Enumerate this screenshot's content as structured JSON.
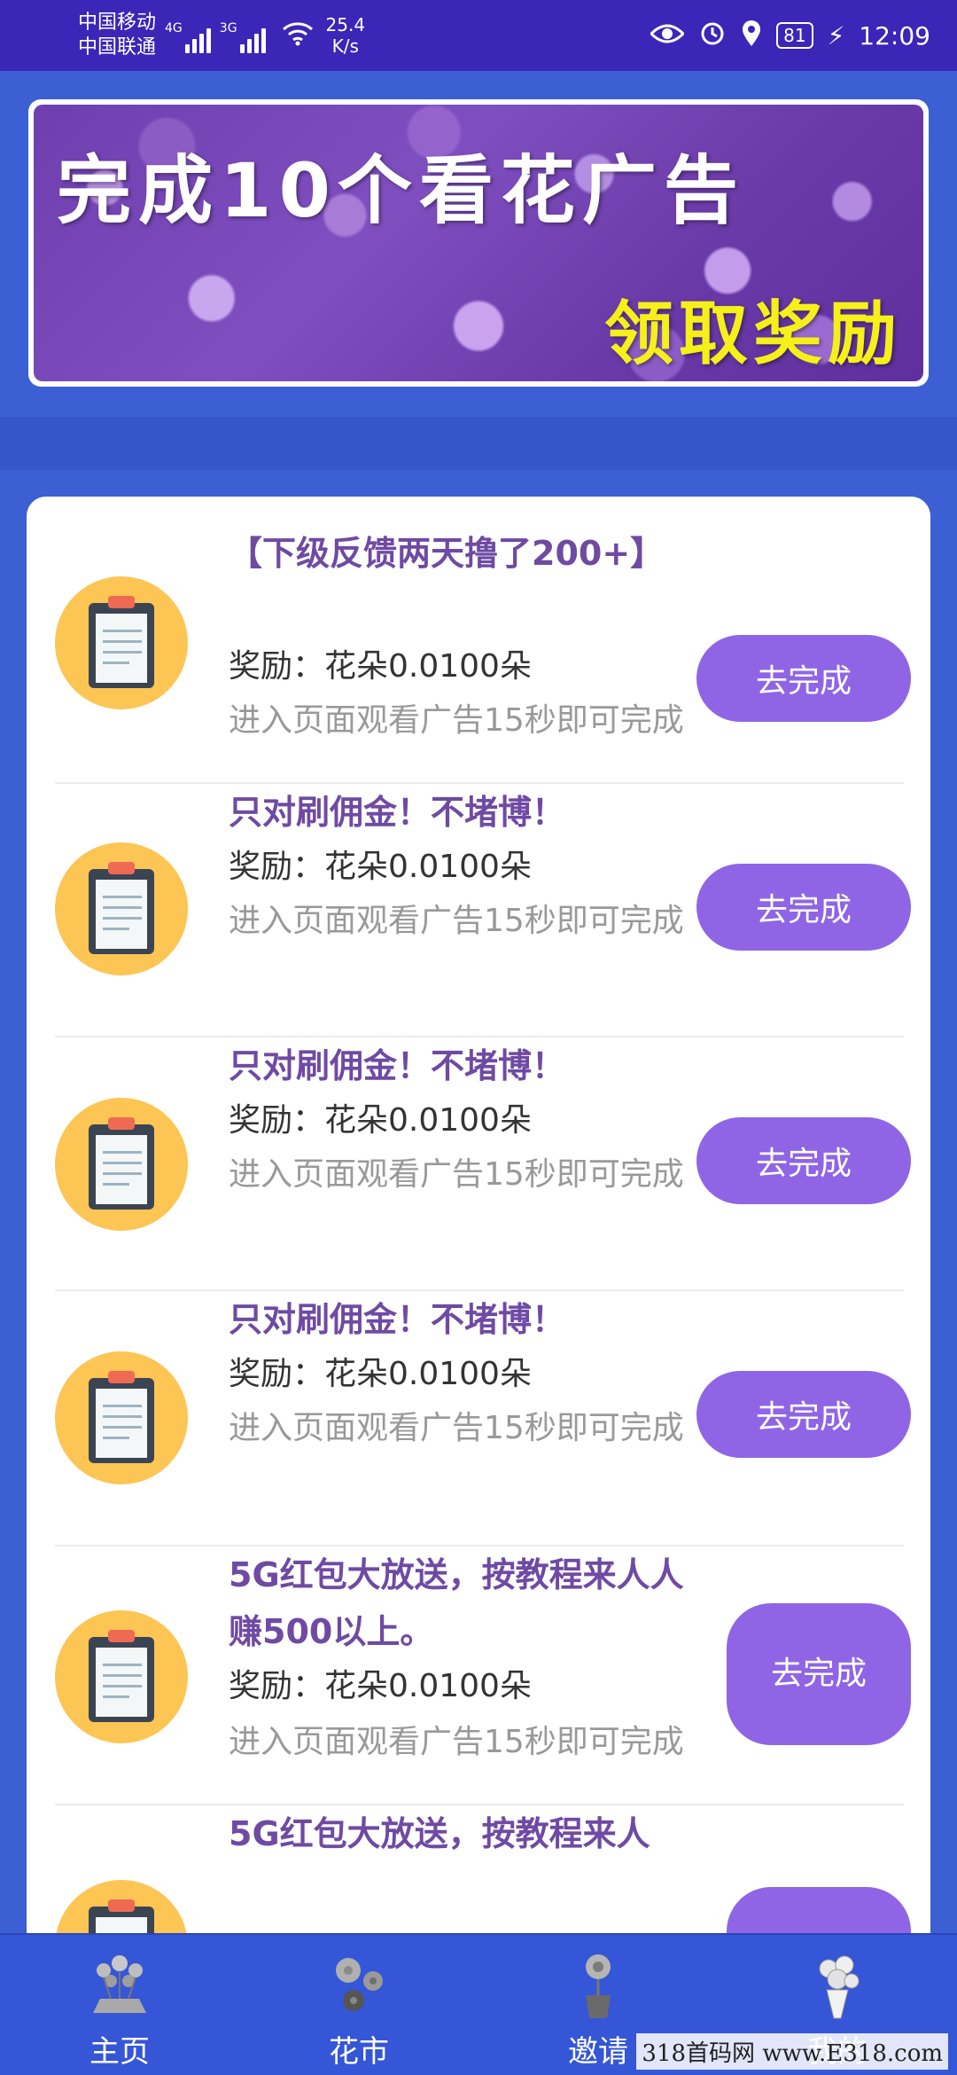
{
  "status_bar": {
    "carrier1": "中国移动",
    "carrier2": "中国联通",
    "net1": "4G",
    "net2": "3G",
    "speed_value": "25.4",
    "speed_unit": "K/s",
    "battery": "81",
    "time": "12:09"
  },
  "banner": {
    "title": "完成10个看花广告",
    "subtitle": "领取奖励"
  },
  "tasks": [
    {
      "title": "【下级反馈两天撸了200+】",
      "reward": "奖励：花朵0.0100朵",
      "desc": "进入页面观看广告15秒即可完成",
      "button": "去完成"
    },
    {
      "title": "只对刷佣金！不堵博！",
      "reward": "奖励：花朵0.0100朵",
      "desc": "进入页面观看广告15秒即可完成",
      "button": "去完成"
    },
    {
      "title": "只对刷佣金！不堵博！",
      "reward": "奖励：花朵0.0100朵",
      "desc": "进入页面观看广告15秒即可完成",
      "button": "去完成"
    },
    {
      "title": "只对刷佣金！不堵博！",
      "reward": "奖励：花朵0.0100朵",
      "desc": "进入页面观看广告15秒即可完成",
      "button": "去完成"
    },
    {
      "title": "5G红包大放送，按教程来人人赚500以上。",
      "reward": "奖励：花朵0.0100朵",
      "desc": "进入页面观看广告15秒即可完成",
      "button": "去完成"
    },
    {
      "title": "5G红包大放送，按教程来人",
      "reward": "",
      "desc": "",
      "button": ""
    }
  ],
  "nav": [
    {
      "label": "主页",
      "icon": "potted-flowers-icon"
    },
    {
      "label": "花市",
      "icon": "flower-market-icon"
    },
    {
      "label": "邀请",
      "icon": "flower-pot-icon"
    },
    {
      "label": "我的",
      "icon": "bouquet-icon"
    }
  ],
  "watermark": "318首码网 www.E318.com"
}
